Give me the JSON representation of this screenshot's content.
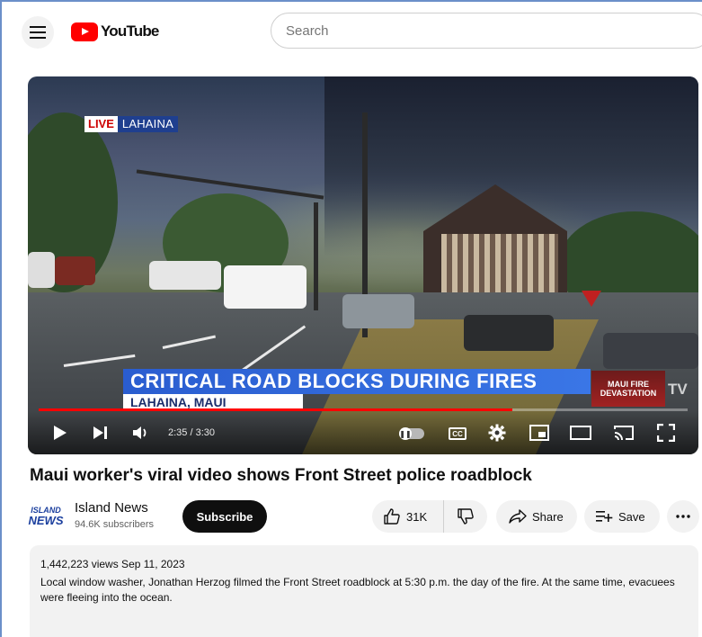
{
  "header": {
    "logo_text": "YouTube",
    "search_placeholder": "Search"
  },
  "video": {
    "live_tag": "LIVE",
    "live_location": "LAHAINA",
    "lower_third_title": "CRITICAL ROAD BLOCKS DURING FIRES",
    "lower_third_subtitle": "LAHAINA, MAUI",
    "bug_line1": "MAUI FIRE",
    "bug_line2": "DEVASTATION",
    "bug_network": "TV",
    "time_display": "2:35 / 3:30",
    "progress_fraction": 0.73
  },
  "title": "Maui worker's viral video shows Front Street police roadblock",
  "channel": {
    "avatar_line1": "ISLAND",
    "avatar_line2": "NEWS",
    "name": "Island News",
    "subscribers": "94.6K subscribers",
    "subscribe_label": "Subscribe"
  },
  "actions": {
    "like_count": "31K",
    "share_label": "Share",
    "save_label": "Save"
  },
  "description": {
    "meta": "1,442,223 views  Sep 11, 2023",
    "text": "Local window washer, Jonathan Herzog filmed the Front Street roadblock at 5:30 p.m. the day of the fire. At the same time, evacuees were fleeing into the ocean."
  },
  "colors": {
    "brand_red": "#ff0000",
    "lower_third_blue": "#2a5dd0"
  }
}
